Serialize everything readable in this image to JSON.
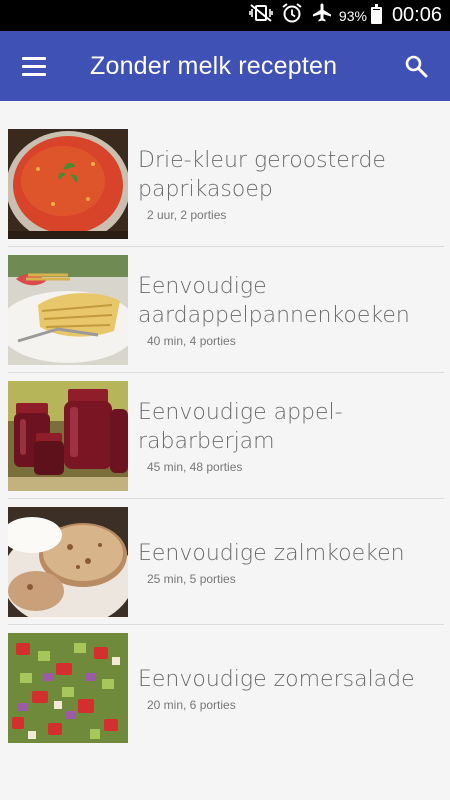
{
  "status_bar": {
    "battery_percent": "93%",
    "battery_level": 0.93,
    "time": "00:06",
    "icons": [
      "vibrate-silent-icon",
      "alarm-clock-icon",
      "airplane-mode-icon",
      "battery-icon"
    ]
  },
  "app_bar": {
    "title": "Zonder melk recepten",
    "menu_icon": "hamburger-menu-icon",
    "search_icon": "search-icon",
    "color": "#3f51b5"
  },
  "recipes": [
    {
      "title": "Drie-kleur geroosterde paprikasoep",
      "meta": "2 uur, 2 porties"
    },
    {
      "title": "Eenvoudige aardappelpannenkoeken",
      "meta": "40 min, 4 porties"
    },
    {
      "title": "Eenvoudige appel-rabarberjam",
      "meta": "45 min, 48 porties"
    },
    {
      "title": "Eenvoudige zalmkoeken",
      "meta": "25 min, 5 porties"
    },
    {
      "title": "Eenvoudige zomersalade",
      "meta": "20 min, 6 porties"
    }
  ]
}
